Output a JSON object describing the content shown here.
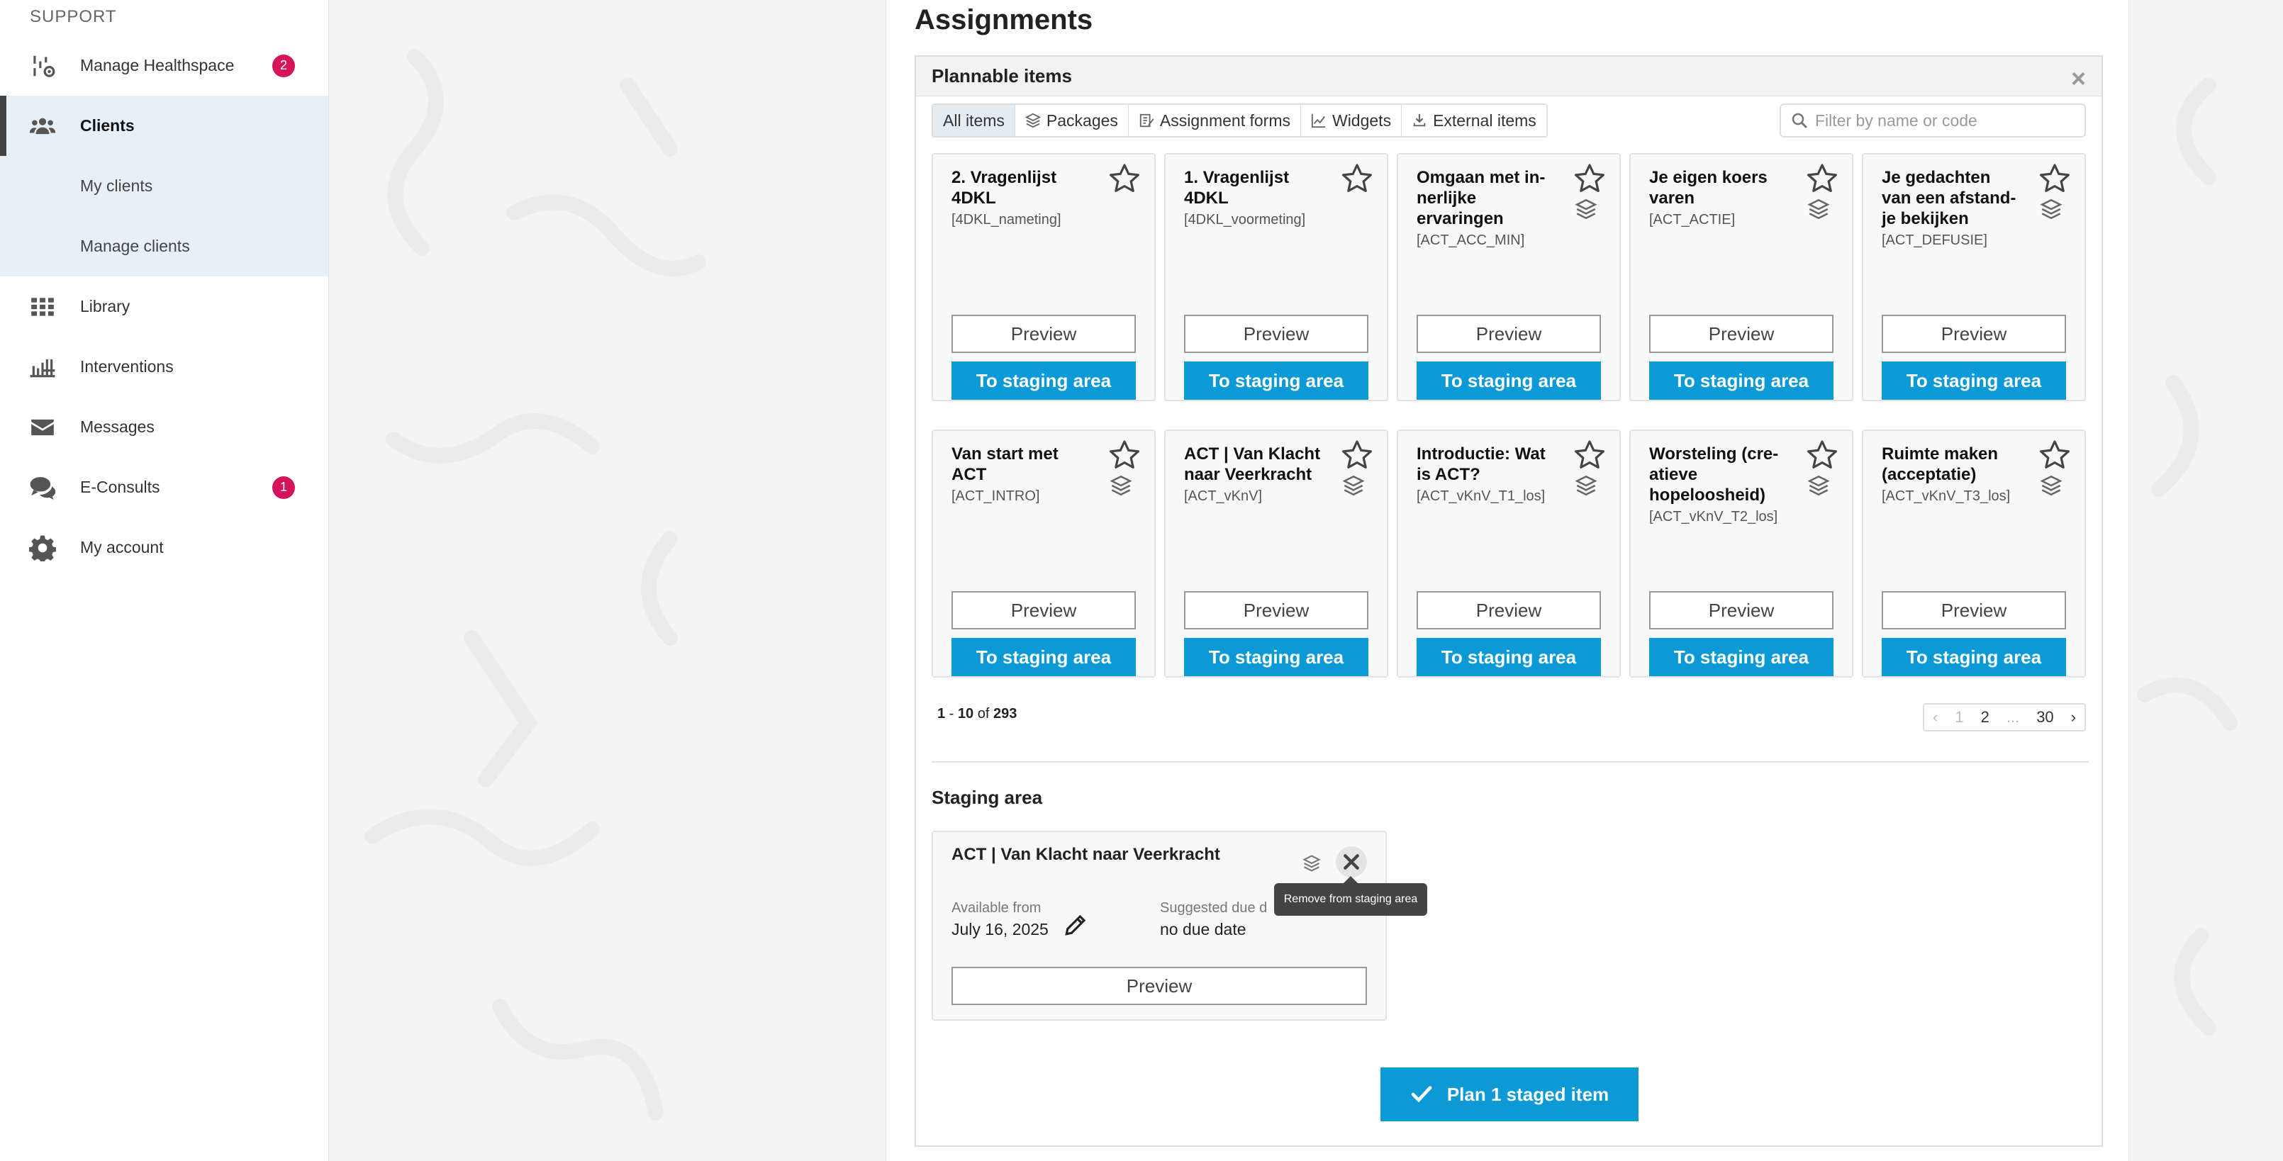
{
  "sidebar": {
    "section_label": "SUPPORT",
    "items": [
      {
        "label": "Manage Healthspace",
        "icon": "settings-flow-icon",
        "badge": "2"
      },
      {
        "label": "Clients",
        "icon": "users-icon",
        "active": true
      },
      {
        "label": "My clients",
        "sub": true
      },
      {
        "label": "Manage clients",
        "sub": true
      },
      {
        "label": "Library",
        "icon": "grid-icon"
      },
      {
        "label": "Interventions",
        "icon": "interventions-icon"
      },
      {
        "label": "Messages",
        "icon": "envelope-icon"
      },
      {
        "label": "E-Consults",
        "icon": "chat-icon",
        "badge": "1"
      },
      {
        "label": "My account",
        "icon": "gear-icon"
      }
    ]
  },
  "page": {
    "title": "Assignments"
  },
  "plannable": {
    "title": "Plannable items",
    "close_glyph": "×",
    "filters": [
      {
        "label": "All items",
        "active": true,
        "icon": ""
      },
      {
        "label": "Packages",
        "icon": "stack-icon"
      },
      {
        "label": "Assignment forms",
        "icon": "form-icon"
      },
      {
        "label": "Widgets",
        "icon": "chart-icon"
      },
      {
        "label": "External items",
        "icon": "external-icon"
      }
    ],
    "search_placeholder": "Filter by name or code",
    "preview_label": "Preview",
    "staging_label": "To staging area",
    "cards": [
      {
        "title": "2. Vragenlijst 4DKL",
        "code": "[4DKL_nameting]",
        "package": false
      },
      {
        "title": "1. Vragenlijst 4DKL",
        "code": "[4DKL_voormeting]",
        "package": false
      },
      {
        "title": "Omgaan met in­nerlijke ervaringen",
        "code": "[ACT_ACC_MIN]",
        "package": true
      },
      {
        "title": "Je eigen koers varen",
        "code": "[ACT_ACTIE]",
        "package": true
      },
      {
        "title": "Je gedachten van een afstand­je bekijken",
        "code": "[ACT_DEFUSIE]",
        "package": true
      },
      {
        "title": "Van start met ACT",
        "code": "[ACT_INTRO]",
        "package": true
      },
      {
        "title": "ACT | Van Klacht naar Veerkracht",
        "code": "[ACT_vKnV]",
        "package": true
      },
      {
        "title": "Introductie: Wat is ACT?",
        "code": "[ACT_vKnV_T1_los]",
        "package": true
      },
      {
        "title": "Worsteling (cre­atieve hopeloosheid)",
        "code": "[ACT_vKnV_T2_los]",
        "package": true
      },
      {
        "title": "Ruimte maken (acceptatie)",
        "code": "[ACT_vKnV_T3_los]",
        "package": true
      }
    ],
    "range": {
      "start": "1",
      "end": "10",
      "of_label": "of",
      "total": "293"
    },
    "pager": {
      "prev": "‹",
      "pages": [
        "1",
        "2",
        "...",
        "30"
      ],
      "next": "›"
    }
  },
  "staging": {
    "title": "Staging area",
    "item": {
      "name": "ACT | Van Klacht naar Veerkracht",
      "available_label": "Available from",
      "available_value": "July 16, 2025",
      "due_label": "Suggested due d",
      "due_value": "no due date",
      "preview_label": "Preview"
    },
    "tooltip": "Remove from staging area",
    "plan_button": "Plan 1 staged item"
  },
  "colors": {
    "accent": "#0b9ad6",
    "badge": "#d6145b",
    "active_bg": "#e8f0f7"
  }
}
